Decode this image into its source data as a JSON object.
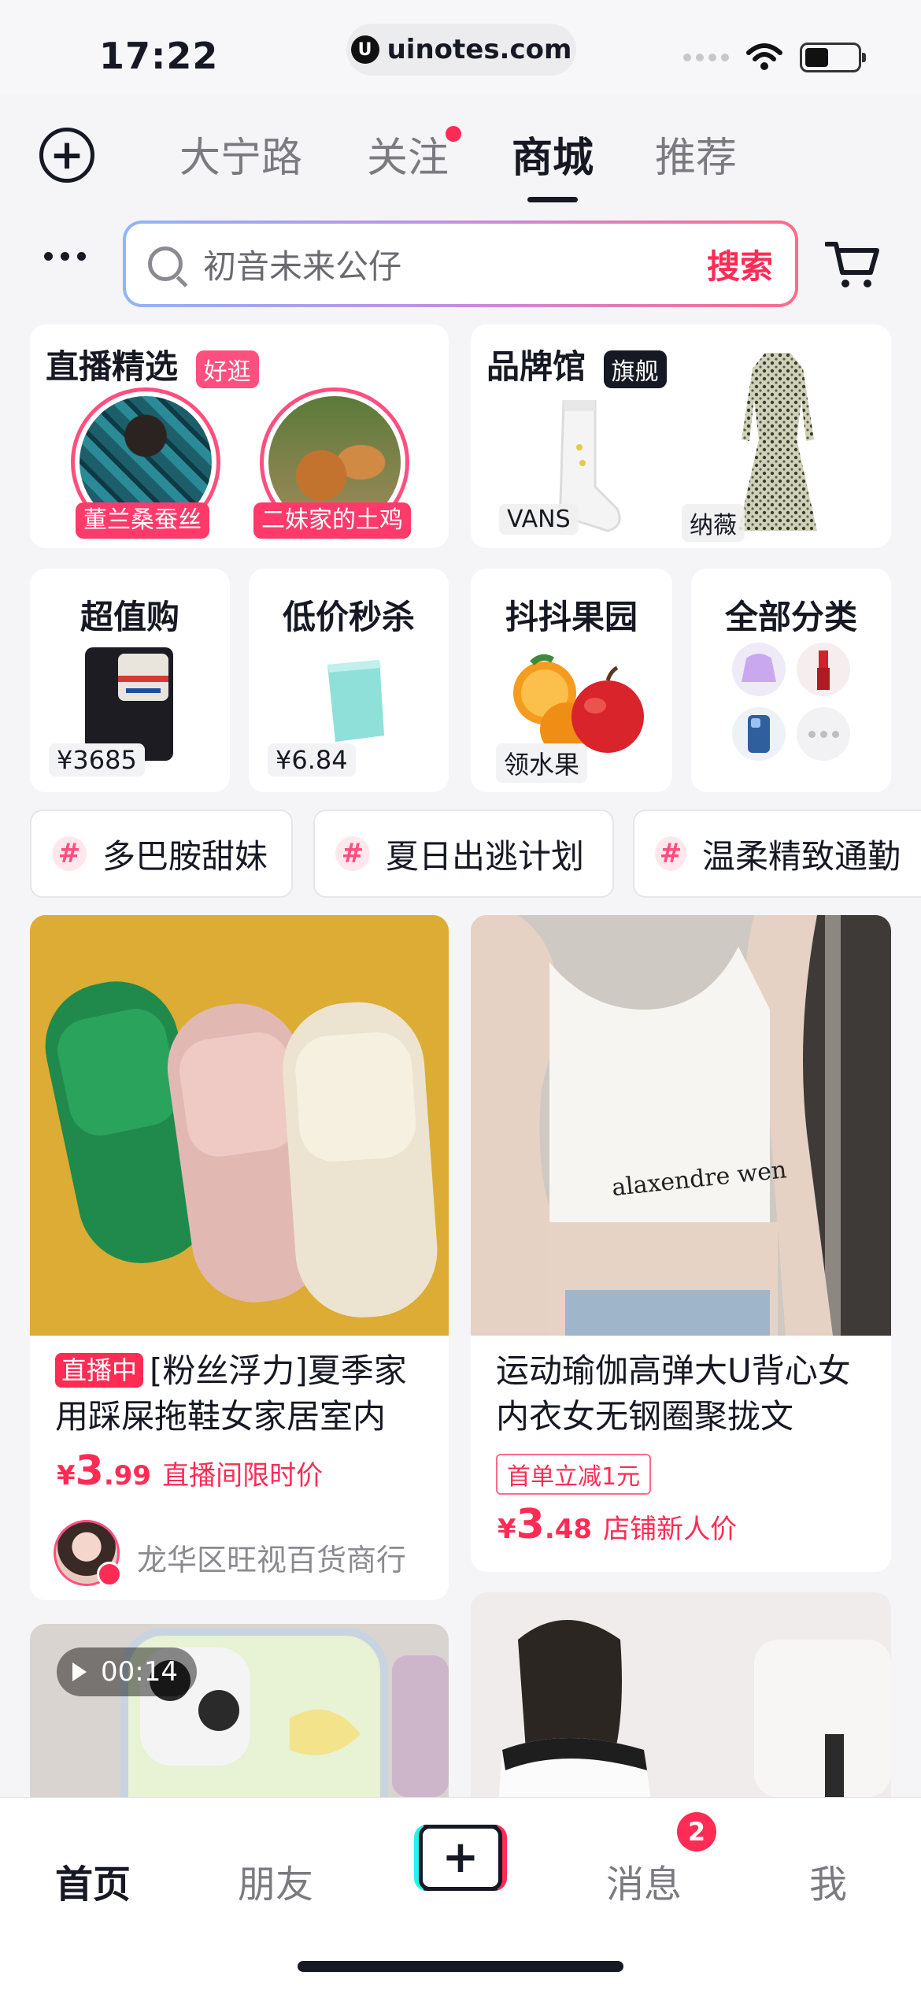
{
  "status": {
    "time": "17:22",
    "url": "uinotes.com"
  },
  "top_tabs": [
    "大宁路",
    "关注",
    "商城",
    "推荐"
  ],
  "search": {
    "placeholder": "初音未来公仔",
    "button": "搜索"
  },
  "live_section": {
    "title": "直播精选",
    "tag": "好逛",
    "rooms": [
      "董兰桑蚕丝",
      "二妹家的土鸡"
    ]
  },
  "brand_section": {
    "title": "品牌馆",
    "tag": "旗舰",
    "brands": [
      "VANS",
      "纳薇"
    ]
  },
  "mini_cards": [
    {
      "title": "超值购",
      "price": "¥3685"
    },
    {
      "title": "低价秒杀",
      "price": "¥6.84"
    },
    {
      "title": "抖抖果园",
      "price": "领水果"
    },
    {
      "title": "全部分类"
    }
  ],
  "topics": [
    "多巴胺甜妹",
    "夏日出逃计划",
    "温柔精致通勤"
  ],
  "products": [
    {
      "badge": "直播中",
      "title": "[粉丝浮力]夏季家用踩屎拖鞋女家居室内",
      "price_currency": "¥",
      "price_int": "3",
      "price_dec": ".99",
      "price_note": "直播间限时价",
      "shop": "龙华区旺视百货商行"
    },
    {
      "title": "运动瑜伽高弹大U背心女 内衣女无钢圈聚拢文",
      "coupon": "首单立减1元",
      "price_currency": "¥",
      "price_int": "3",
      "price_dec": ".48",
      "price_note": "店铺新人价"
    },
    {
      "video_time": "00:14"
    }
  ],
  "bottom_tabs": {
    "home": "首页",
    "friends": "朋友",
    "messages": "消息",
    "me": "我",
    "message_badge": "2"
  },
  "colors": {
    "accent": "#fe2c55",
    "text": "#161823",
    "muted": "#7a7a80"
  }
}
